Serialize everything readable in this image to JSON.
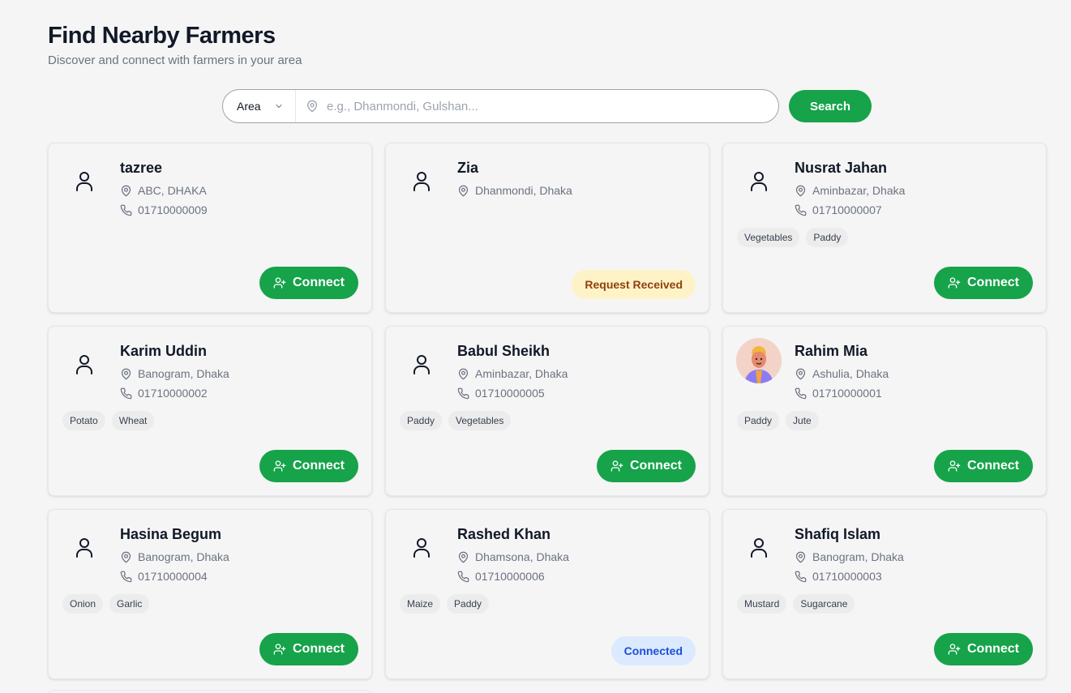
{
  "header": {
    "title": "Find Nearby Farmers",
    "subtitle": "Discover and connect with farmers in your area"
  },
  "search": {
    "filter_label": "Area",
    "placeholder": "e.g., Dhanmondi, Gulshan...",
    "button_label": "Search"
  },
  "connect_label": "Connect",
  "farmers": [
    {
      "name": "tazree",
      "location": "ABC, DHAKA",
      "phone": "01710000009",
      "tags": [],
      "action": "connect",
      "avatar": "person-icon"
    },
    {
      "name": "Zia",
      "location": "Dhanmondi, Dhaka",
      "phone": "",
      "tags": [],
      "action": "status",
      "status": "Request Received",
      "status_kind": "pending",
      "avatar": "person-icon"
    },
    {
      "name": "Nusrat Jahan",
      "location": "Aminbazar, Dhaka",
      "phone": "01710000007",
      "tags": [
        "Vegetables",
        "Paddy"
      ],
      "action": "connect",
      "avatar": "person-icon"
    },
    {
      "name": "Karim Uddin",
      "location": "Banogram, Dhaka",
      "phone": "01710000002",
      "tags": [
        "Potato",
        "Wheat"
      ],
      "action": "connect",
      "avatar": "person-icon"
    },
    {
      "name": "Babul Sheikh",
      "location": "Aminbazar, Dhaka",
      "phone": "01710000005",
      "tags": [
        "Paddy",
        "Vegetables"
      ],
      "action": "connect",
      "avatar": "person-icon"
    },
    {
      "name": "Rahim Mia",
      "location": "Ashulia, Dhaka",
      "phone": "01710000001",
      "tags": [
        "Paddy",
        "Jute"
      ],
      "action": "connect",
      "avatar": "photo"
    },
    {
      "name": "Hasina Begum",
      "location": "Banogram, Dhaka",
      "phone": "01710000004",
      "tags": [
        "Onion",
        "Garlic"
      ],
      "action": "connect",
      "avatar": "person-icon"
    },
    {
      "name": "Rashed Khan",
      "location": "Dhamsona, Dhaka",
      "phone": "01710000006",
      "tags": [
        "Maize",
        "Paddy"
      ],
      "action": "status",
      "status": "Connected",
      "status_kind": "connected",
      "avatar": "person-icon"
    },
    {
      "name": "Shafiq Islam",
      "location": "Banogram, Dhaka",
      "phone": "01710000003",
      "tags": [
        "Mustard",
        "Sugarcane"
      ],
      "action": "connect",
      "avatar": "person-icon"
    }
  ]
}
